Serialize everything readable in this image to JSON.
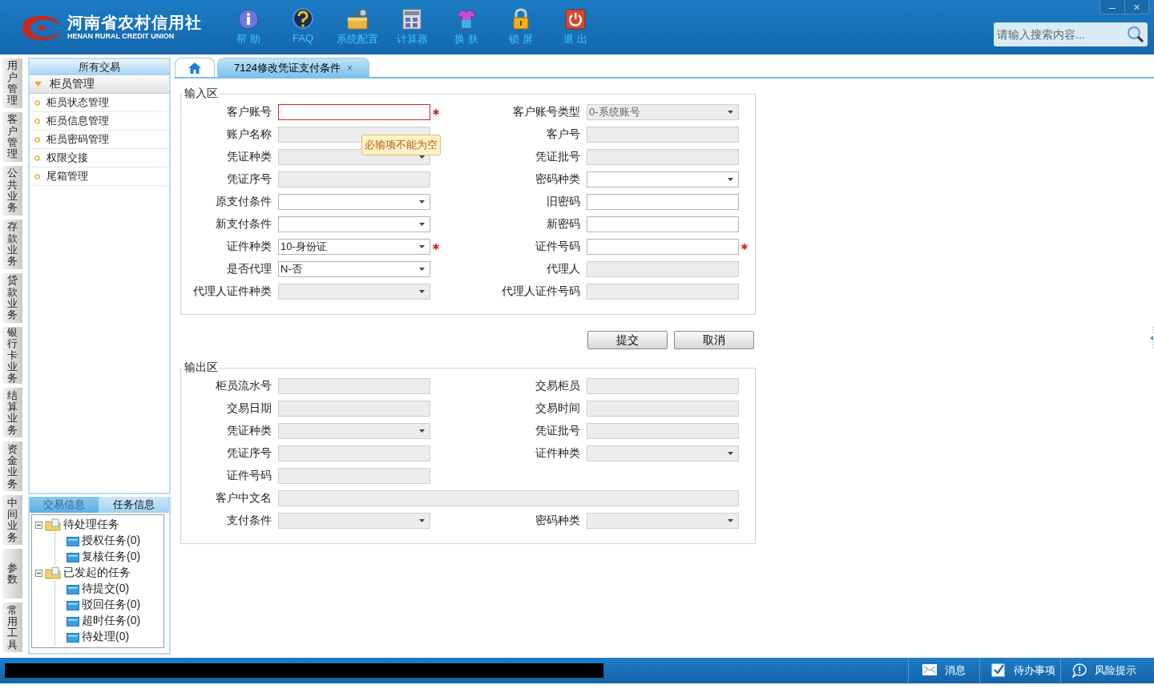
{
  "header": {
    "logo": {
      "title": "河南省农村信用社",
      "subtitle": "HENAN RURAL CREDIT UNION"
    },
    "toolbar": [
      {
        "kind": "info",
        "label": "帮 助"
      },
      {
        "kind": "faq",
        "label": "FAQ"
      },
      {
        "kind": "config",
        "label": "系统配置"
      },
      {
        "kind": "calculator",
        "label": "计算器"
      },
      {
        "kind": "skin",
        "label": "换 肤"
      },
      {
        "kind": "lock",
        "label": "锁 屏"
      },
      {
        "kind": "exit",
        "label": "退 出"
      }
    ],
    "window_controls": [
      "–",
      "×"
    ],
    "search": {
      "placeholder": "请输入搜索内容..."
    }
  },
  "side_tabs": [
    "用户管理",
    "客户管理",
    "公共业务",
    "存款业务",
    "贷款业务",
    "银行卡业务",
    "结算业务",
    "资金业务",
    "中间业务",
    "参数",
    "常用工具"
  ],
  "nav": {
    "title": "所有交易",
    "group": {
      "label": "柜员管理",
      "expanded": true,
      "items": [
        "柜员状态管理",
        "柜员信息管理",
        "柜员密码管理",
        "权限交接",
        "尾箱管理"
      ]
    }
  },
  "task_panel": {
    "tabs": [
      {
        "label": "交易信息",
        "selected": false
      },
      {
        "label": "任务信息",
        "selected": true
      }
    ],
    "tree": [
      {
        "label": "待处理任务",
        "expanded": true,
        "children": [
          {
            "label": "授权任务(0)"
          },
          {
            "label": "复核任务(0)"
          }
        ]
      },
      {
        "label": "已发起的任务",
        "expanded": true,
        "children": [
          {
            "label": "待提交(0)"
          },
          {
            "label": "驳回任务(0)"
          },
          {
            "label": "超时任务(0)"
          },
          {
            "label": "待处理(0)"
          }
        ]
      }
    ]
  },
  "doc_tabs": [
    {
      "kind": "home",
      "selected": false
    },
    {
      "kind": "page",
      "label": "7124修改凭证支付条件",
      "close": "×",
      "selected": true
    }
  ],
  "input_area": {
    "legend": "输入区",
    "tooltip": "必输项不能为空",
    "fields": [
      {
        "label": "客户账号",
        "kind": "text",
        "disabled": false,
        "required": true,
        "error": true
      },
      {
        "label": "客户账号类型",
        "kind": "select",
        "disabled": true,
        "value": "0-系统账号"
      },
      {
        "label": "账户名称",
        "kind": "text",
        "disabled": true
      },
      {
        "label": "客户号",
        "kind": "text",
        "disabled": true
      },
      {
        "label": "凭证种类",
        "kind": "select",
        "disabled": true
      },
      {
        "label": "凭证批号",
        "kind": "text",
        "disabled": true
      },
      {
        "label": "凭证序号",
        "kind": "text",
        "disabled": true
      },
      {
        "label": "密码种类",
        "kind": "select",
        "disabled": false
      },
      {
        "label": "原支付条件",
        "kind": "select",
        "disabled": false
      },
      {
        "label": "旧密码",
        "kind": "text",
        "disabled": false
      },
      {
        "label": "新支付条件",
        "kind": "select",
        "disabled": false
      },
      {
        "label": "新密码",
        "kind": "text",
        "disabled": false
      },
      {
        "label": "证件种类",
        "kind": "select",
        "disabled": false,
        "value": "10-身份证",
        "required": true
      },
      {
        "label": "证件号码",
        "kind": "text",
        "disabled": false,
        "required": true
      },
      {
        "label": "是否代理",
        "kind": "select",
        "disabled": false,
        "value": "N-否"
      },
      {
        "label": "代理人",
        "kind": "text",
        "disabled": true
      },
      {
        "label": "代理人证件种类",
        "kind": "select",
        "disabled": true
      },
      {
        "label": "代理人证件号码",
        "kind": "text",
        "disabled": true
      }
    ]
  },
  "buttons": [
    "提交",
    "取消"
  ],
  "output_area": {
    "legend": "输出区",
    "fields": [
      {
        "label": "柜员流水号",
        "kind": "text",
        "disabled": true
      },
      {
        "label": "交易柜员",
        "kind": "text",
        "disabled": true
      },
      {
        "label": "交易日期",
        "kind": "text",
        "disabled": true
      },
      {
        "label": "交易时间",
        "kind": "text",
        "disabled": true
      },
      {
        "label": "凭证种类",
        "kind": "select",
        "disabled": true
      },
      {
        "label": "凭证批号",
        "kind": "text",
        "disabled": true
      },
      {
        "label": "凭证序号",
        "kind": "text",
        "disabled": true
      },
      {
        "label": "证件种类",
        "kind": "select",
        "disabled": true
      },
      {
        "label": "证件号码",
        "kind": "text",
        "disabled": true
      },
      {
        "label": "客户中文名",
        "kind": "text",
        "disabled": true,
        "wide": true
      },
      {
        "label": "支付条件",
        "kind": "select",
        "disabled": true
      },
      {
        "label": "密码种类",
        "kind": "select",
        "disabled": true
      }
    ]
  },
  "status_bar": {
    "items": [
      {
        "kind": "message",
        "label": "消息"
      },
      {
        "kind": "todo",
        "label": "待办事项"
      },
      {
        "kind": "risk",
        "label": "风险提示"
      }
    ]
  }
}
